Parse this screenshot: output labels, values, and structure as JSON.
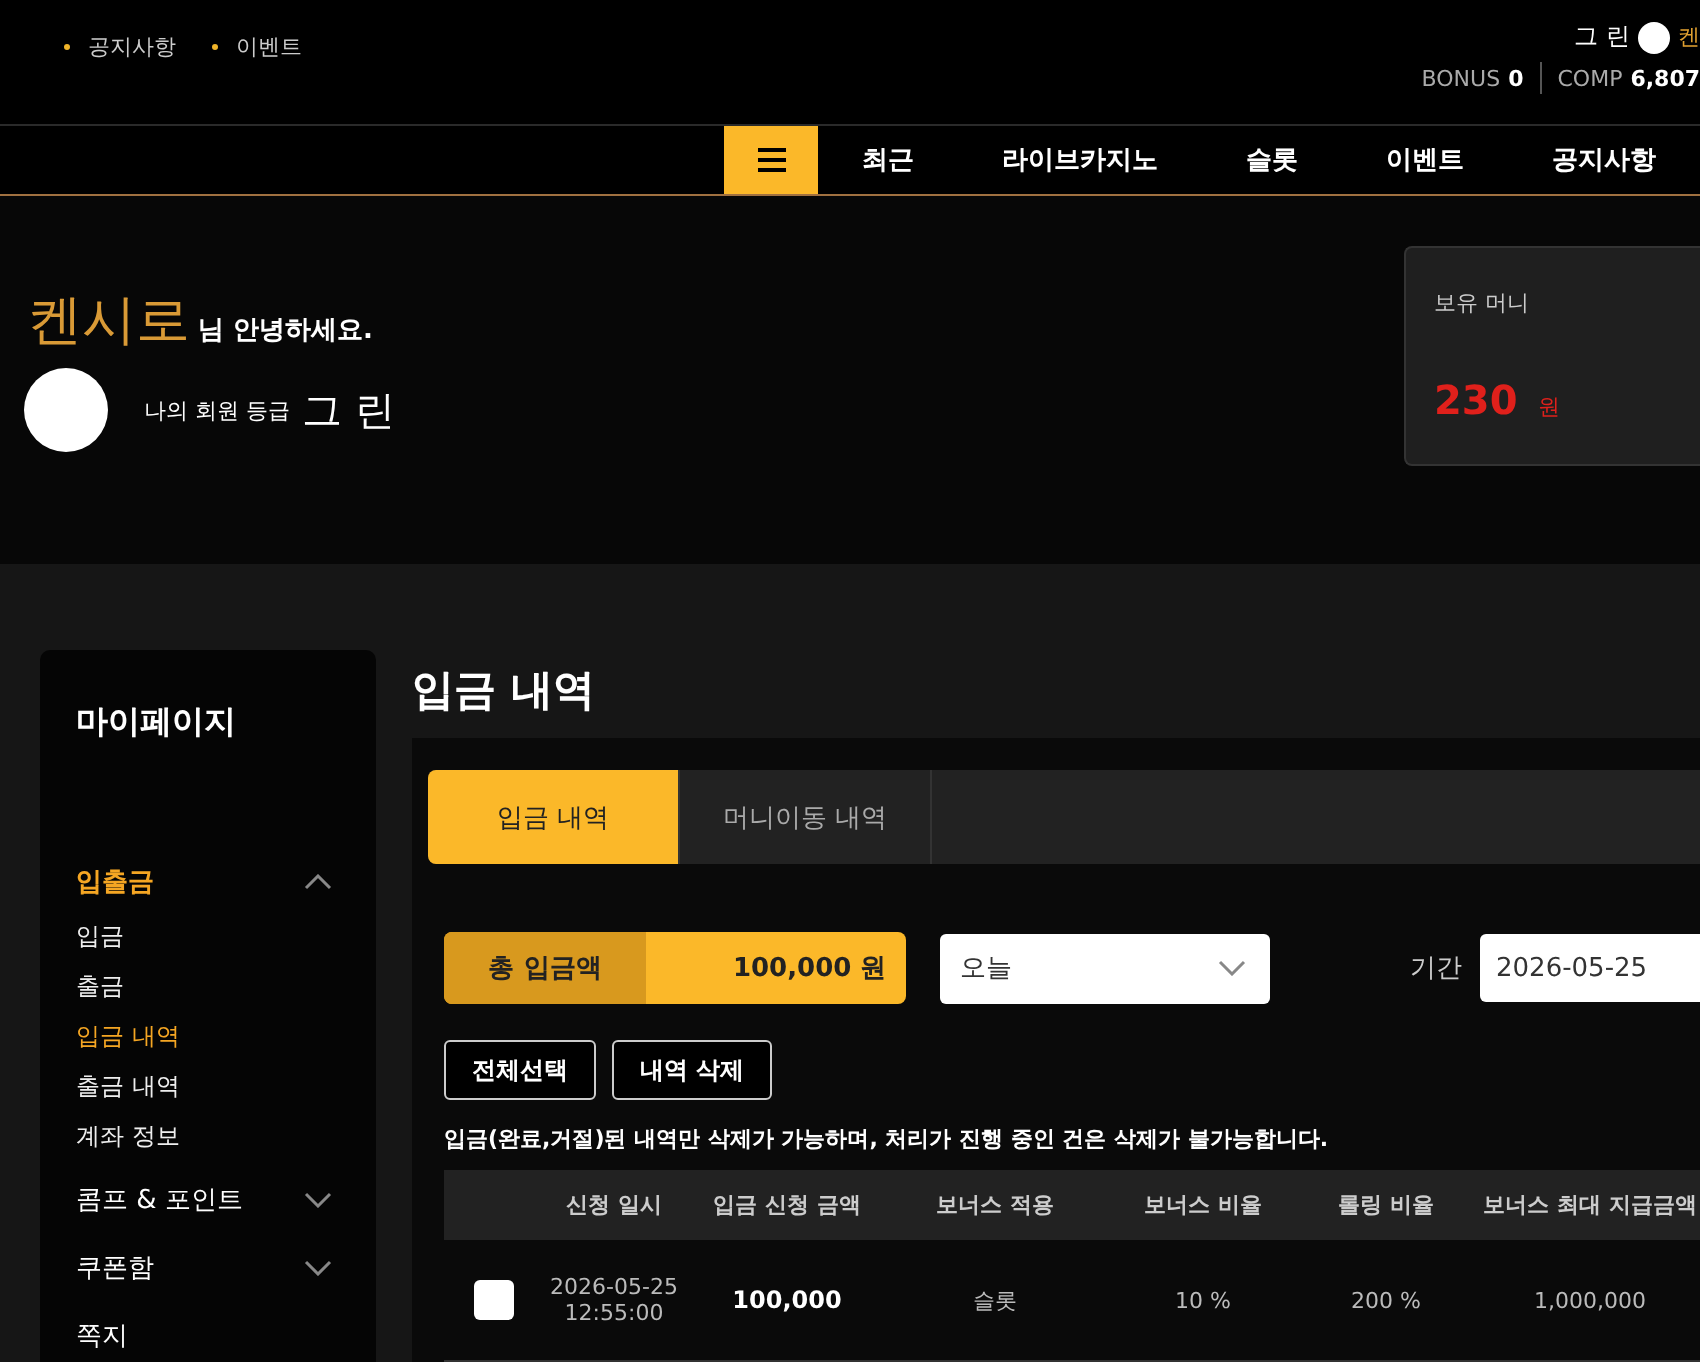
{
  "top_links": [
    "공지사항",
    "이벤트"
  ],
  "user": {
    "grade": "그 린",
    "name": "켄",
    "bonus_label": "BONUS",
    "bonus": "0",
    "comp_label": "COMP",
    "comp": "6,807"
  },
  "nav": {
    "items": [
      "최근",
      "라이브카지노",
      "슬롯",
      "이벤트",
      "공지사항"
    ]
  },
  "hero": {
    "name": "켄시로",
    "greeting": "님 안녕하세요.",
    "grade_label": "나의 회원 등급",
    "grade": "그 린"
  },
  "money_card": {
    "label": "보유 머니",
    "amount": "230",
    "unit": "원"
  },
  "sidebar": {
    "title": "마이페이지",
    "items": [
      {
        "label": "입출금",
        "expanded": true,
        "children": [
          {
            "label": "입금",
            "selected": false
          },
          {
            "label": "출금",
            "selected": false
          },
          {
            "label": "입금 내역",
            "selected": true
          },
          {
            "label": "출금 내역",
            "selected": false
          },
          {
            "label": "계좌 정보",
            "selected": false
          }
        ]
      },
      {
        "label": "콤프 & 포인트",
        "expanded": false
      },
      {
        "label": "쿠폰함",
        "expanded": false
      },
      {
        "label": "쪽지"
      }
    ]
  },
  "page_title": "입금 내역",
  "tabs": [
    {
      "label": "입금 내역",
      "selected": true
    },
    {
      "label": "머니이동 내역",
      "selected": false
    }
  ],
  "total": {
    "label": "총 입금액",
    "value": "100,000 원"
  },
  "period_select": {
    "value": "오늘"
  },
  "period_label": "기간",
  "date_field": {
    "value": "2026-05-25"
  },
  "buttons": [
    "전체선택",
    "내역 삭제"
  ],
  "notice": "입금(완료,거절)된 내역만 삭제가 가능하며, 처리가 진행 중인 건은 삭제가 불가능합니다.",
  "table": {
    "columns": [
      "신청 일시",
      "입금 신청 금액",
      "보너스 적용",
      "보너스 비율",
      "롤링 비율",
      "보너스 최대 지급금액"
    ],
    "rows": [
      {
        "checked": false,
        "cells": [
          "2026-05-25\n12:55:00",
          "100,000",
          "슬롯",
          "10 %",
          "200 %",
          "1,000,000"
        ]
      }
    ]
  }
}
